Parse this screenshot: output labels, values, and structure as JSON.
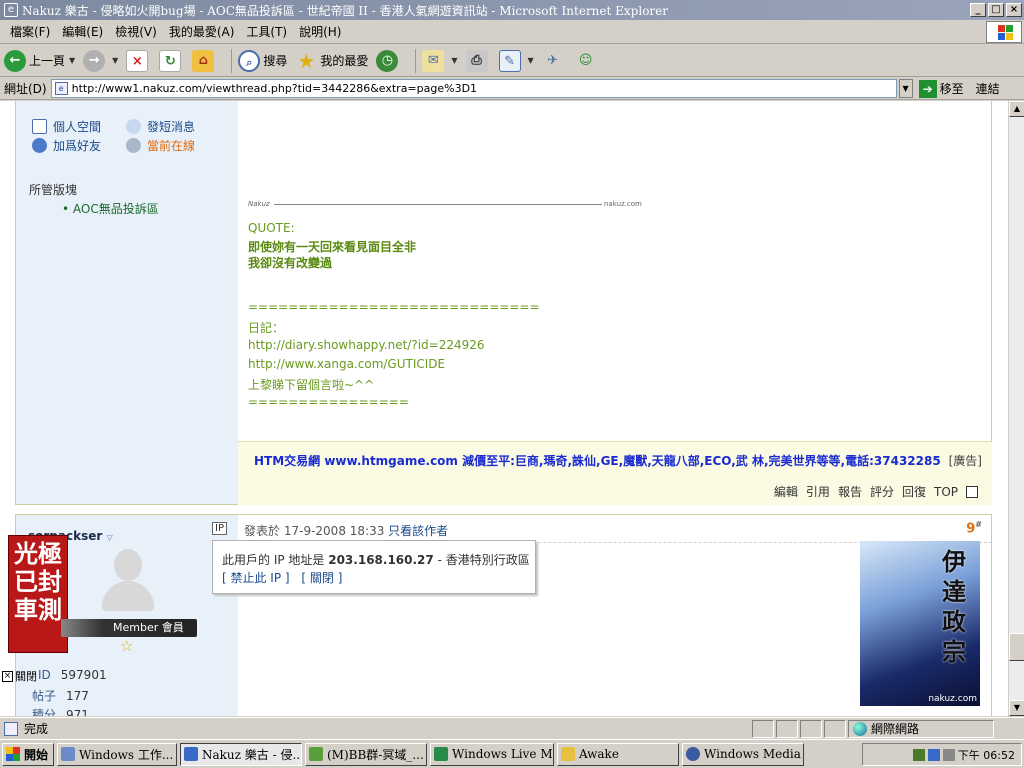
{
  "window": {
    "title": "Nakuz 樂古 - 侵略如火開bug場 - AOC無品投訴區 - 世紀帝國 II - 香港人氣網遊資訊站 - Microsoft Internet Explorer",
    "min": "_",
    "max": "□",
    "close": "×"
  },
  "menu": [
    "檔案(F)",
    "編輯(E)",
    "檢視(V)",
    "我的最愛(A)",
    "工具(T)",
    "說明(H)"
  ],
  "toolbar": {
    "back": "上一頁",
    "search": "搜尋",
    "favorites": "我的最愛"
  },
  "address": {
    "label": "網址(D)",
    "url": "http://www1.nakuz.com/viewthread.php?tid=3442286&extra=page%3D1",
    "go": "移至",
    "links": "連結"
  },
  "post1": {
    "side": {
      "space": "個人空間",
      "pm": "發短消息",
      "add_friend": "加爲好友",
      "online": "當前在線",
      "moderator_title": "所管版塊",
      "moderator_item": "• AOC無品投訴區"
    },
    "signature": {
      "logo": "Nakuz",
      "site": "nakuz.com",
      "quote_label": "QUOTE:",
      "quote_line1": "即使妳有一天回來看見面目全非",
      "quote_line2": "我卻沒有改變過",
      "divider1": "=============================",
      "diary_label": "日記：",
      "link1": "http://diary.showhappy.net/?id=224926",
      "link2": "http://www.xanga.com/GUTICIDE",
      "note": "上黎睇下留個言啦~^^",
      "divider2": "================"
    },
    "ad": {
      "text": "HTM交易網 www.htmgame.com 減價至平:巨商,瑪奇,誅仙,GE,魔獸,天龍八部,ECO,武 林,完美世界等等,電話:37432285",
      "tag": "[廣告]"
    },
    "actions": [
      "編輯",
      "引用",
      "報告",
      "評分",
      "回復",
      "TOP"
    ]
  },
  "post2": {
    "username": "sorpack",
    "username_suffix": "ser",
    "banner_text": "光極已封車測",
    "rank": "Member 會員",
    "close_image": "關閉",
    "uid_label": "ID",
    "uid_value": "597901",
    "posts_label": "帖子",
    "posts_value": "177",
    "points_label": "積分",
    "points_value": "971",
    "ip_button": "IP",
    "posted_prefix": "發表於",
    "posted_time": "17-9-2008 18:33",
    "only_author": "只看該作者",
    "floor": "9",
    "floor_mark": "#",
    "art_text": "伊達政宗",
    "art_watermark": "nakuz.com"
  },
  "ip_popup": {
    "prefix": "此用戶的 IP 地址是",
    "ip": "203.168.160.27",
    "location": "- 香港特別行政區",
    "ban": "[ 禁止此 IP ]",
    "close": "[ 關閉 ]"
  },
  "status": {
    "text": "完成",
    "zone": "網際網路"
  },
  "taskbar": {
    "start": "開始",
    "tasks": [
      "Windows 工作...",
      "Nakuz 樂古 - 侵...",
      "(M)BB群-冥域_...",
      "Windows Live M...",
      "Awake",
      "Windows Media ..."
    ],
    "clock": "下午 06:52"
  },
  "colors": {
    "sidebar_bg": "#e8f1fa",
    "signature_green": "#6a9a20",
    "ad_blue": "#1a2ad0",
    "ad_bg": "#fbfbe4",
    "floor_orange": "#e07010"
  }
}
